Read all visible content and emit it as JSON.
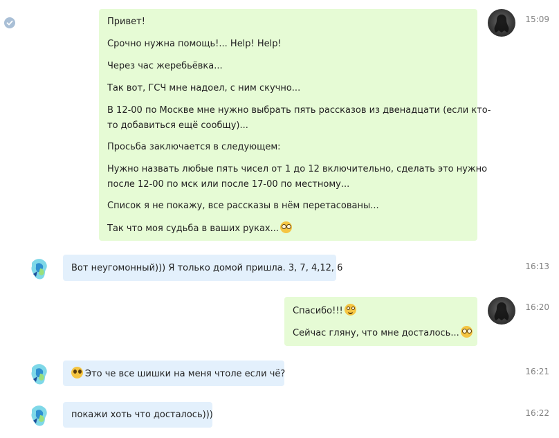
{
  "chat": {
    "read_icon": "checkmark-circle-icon",
    "messages": [
      {
        "id": "m1",
        "direction": "out",
        "time": "15:09",
        "lines": [
          "Привет!",
          "Срочно нужна помощь!...  Help! Help!",
          "Через час жеребьёвка...",
          "Так вот, ГСЧ мне надоел, с ним скучно...",
          "В 12-00 по Москве мне нужно выбрать пять рассказов из двенадцати (если кто-",
          "то добавиться ещё сообщу)...",
          "Просьба заключается в следующем:",
          "Нужно назвать любые пять чисел от 1 до 12 включительно, сделать это нужно",
          "после 12-00 по мск или после 17-00 по местному...",
          "Список я не покажу, все рассказы в нём перетасованы...",
          "Так что моя судьба в ваших руках..."
        ],
        "emoji": "nerd-glasses-emoji"
      },
      {
        "id": "m2",
        "direction": "in",
        "time": "16:13",
        "text": "Вот неугомонный))) Я только домой пришла. 3, 7, 4,12, 6"
      },
      {
        "id": "m3",
        "direction": "out",
        "time": "16:20",
        "line1": "Спасибо!!!",
        "line1_emoji": "smiling-emoji",
        "line2": "Сейчас гляну, что мне досталось...",
        "line2_emoji": "nerd-glasses-emoji"
      },
      {
        "id": "m4",
        "direction": "in",
        "time": "16:21",
        "emoji": "surprised-emoji",
        "text": "Это че все шишки на меня чтоле если чё?"
      },
      {
        "id": "m5",
        "direction": "in",
        "time": "16:22",
        "text": "покажи хоть что досталось)))"
      }
    ]
  },
  "colors": {
    "outgoing_bubble": "#e6fbd5",
    "incoming_bubble": "#e3f0fc",
    "timestamp": "#828282",
    "text": "#222222"
  }
}
